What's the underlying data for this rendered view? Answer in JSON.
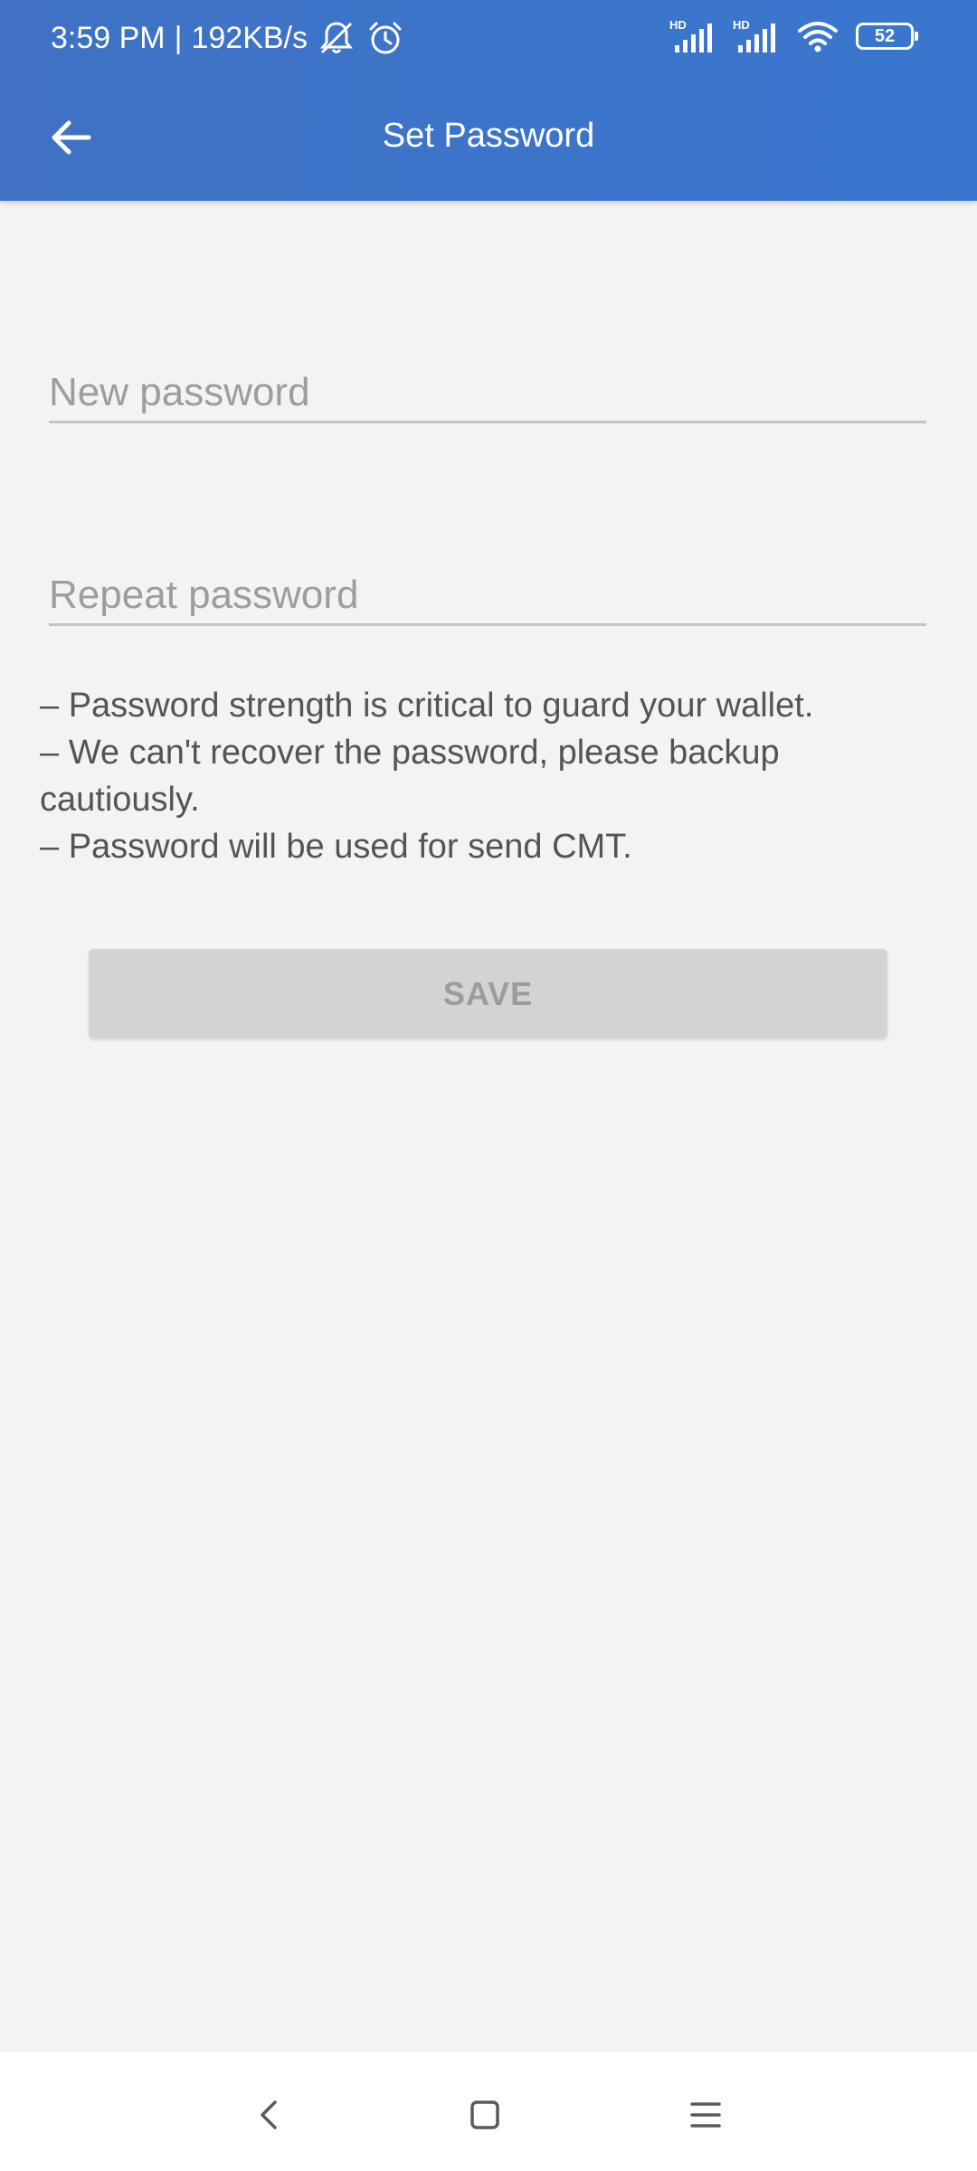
{
  "status_bar": {
    "time": "3:59 PM",
    "separator": "|",
    "net_speed": "192KB/s",
    "battery": "52",
    "icons": [
      "mute-notifications-icon",
      "alarm-icon",
      "signal-hd-icon",
      "signal-hd-icon",
      "wifi-icon",
      "battery-icon"
    ]
  },
  "app_bar": {
    "title": "Set Password",
    "back_icon": "arrow-left-icon"
  },
  "form": {
    "new_password": {
      "placeholder": "New password",
      "value": ""
    },
    "repeat_password": {
      "placeholder": "Repeat password",
      "value": ""
    }
  },
  "tips": [
    "– Password strength is critical to guard your wallet.",
    "– We can't recover the password, please backup cautiously.",
    "– Password will be used for send CMT."
  ],
  "save_button": {
    "label": "SAVE",
    "enabled": false
  },
  "nav_bar": {
    "icons": [
      "nav-back-icon",
      "nav-home-icon",
      "nav-recents-icon"
    ]
  },
  "colors": {
    "app_bar": "#3a76cf",
    "background": "#f3f3f3",
    "button_disabled": "#d3d3d3",
    "button_text_disabled": "#9c9c9c",
    "tip_text": "#545454",
    "placeholder": "#9d9d9d"
  }
}
